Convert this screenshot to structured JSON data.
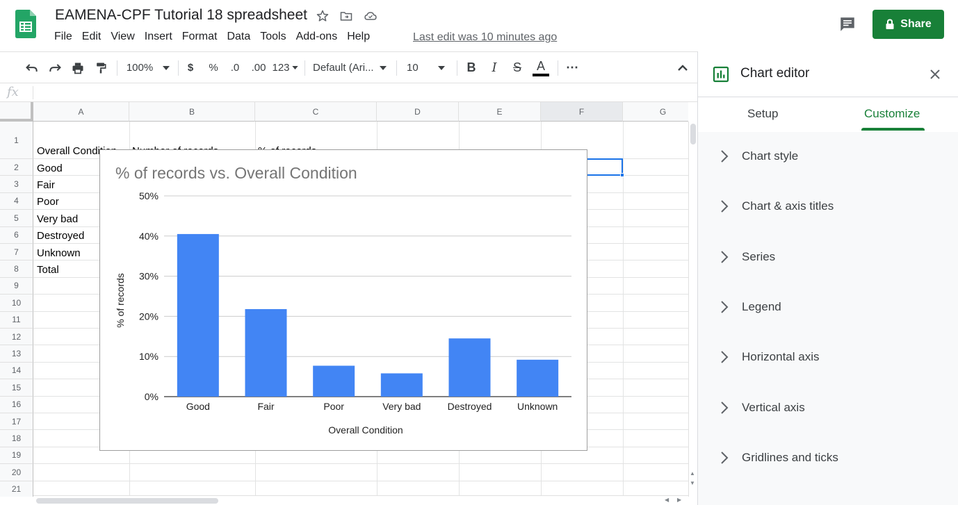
{
  "app": {
    "doc_title": "EAMENA-CPF Tutorial 18 spreadsheet",
    "menu": [
      "File",
      "Edit",
      "View",
      "Insert",
      "Format",
      "Data",
      "Tools",
      "Add-ons",
      "Help"
    ],
    "last_edit": "Last edit was 10 minutes ago",
    "share_label": "Share",
    "accent_color": "#188038"
  },
  "toolbar": {
    "zoom": "100%",
    "currency": "$",
    "percent": "%",
    "dec_less": ".0",
    "dec_more": ".00",
    "number_format": "123",
    "font": "Default (Ari...",
    "font_size": "10",
    "bold": "B",
    "italic": "I",
    "strike": "S",
    "text_color": "A",
    "more": "⋯"
  },
  "formula_bar": {
    "fx": "fx"
  },
  "sheet": {
    "columns": [
      "A",
      "B",
      "C",
      "D",
      "E",
      "F",
      "G"
    ],
    "rows": [
      "1",
      "2",
      "3",
      "4",
      "5",
      "6",
      "7",
      "8",
      "9",
      "10",
      "11",
      "12",
      "13",
      "14",
      "15",
      "16",
      "17",
      "18",
      "19",
      "20",
      "21"
    ],
    "cells_a": [
      "Overall Condition",
      "Good",
      "Fair",
      "Poor",
      "Very bad",
      "Destroyed",
      "Unknown",
      "Total"
    ],
    "header_b_partial": "Number of records",
    "header_c_partial": "% of records"
  },
  "chart_data": {
    "type": "bar",
    "title": "% of records vs. Overall Condition",
    "xlabel": "Overall Condition",
    "ylabel": "% of records",
    "categories": [
      "Good",
      "Fair",
      "Poor",
      "Very bad",
      "Destroyed",
      "Unknown"
    ],
    "values": [
      40.5,
      21.8,
      7.7,
      5.8,
      14.5,
      9.2
    ],
    "ylim": [
      0,
      50
    ],
    "yticks": [
      "0%",
      "10%",
      "20%",
      "30%",
      "40%",
      "50%"
    ],
    "grid": true,
    "bar_color": "#4285f4"
  },
  "panel": {
    "title": "Chart editor",
    "tabs": [
      "Setup",
      "Customize"
    ],
    "active_tab": "Customize",
    "sections": [
      "Chart style",
      "Chart & axis titles",
      "Series",
      "Legend",
      "Horizontal axis",
      "Vertical axis",
      "Gridlines and ticks"
    ]
  }
}
